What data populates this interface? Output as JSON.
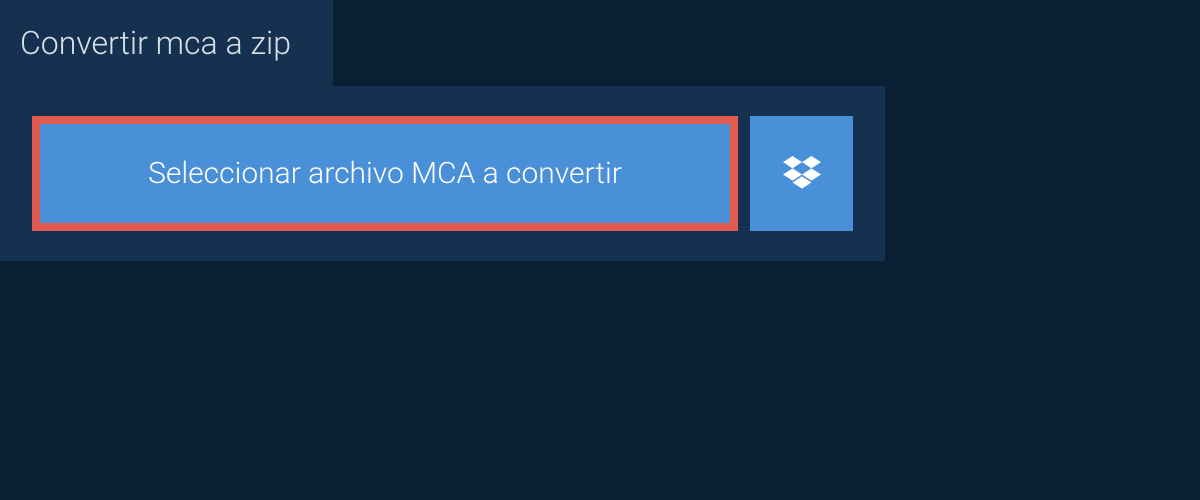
{
  "tab": {
    "label": "Convertir mca a zip"
  },
  "actions": {
    "select_file_label": "Seleccionar archivo MCA a convertir"
  },
  "colors": {
    "background": "#0a1f33",
    "panel": "#15314f",
    "button": "#4a90d9",
    "highlight_border": "#e05a4f"
  }
}
